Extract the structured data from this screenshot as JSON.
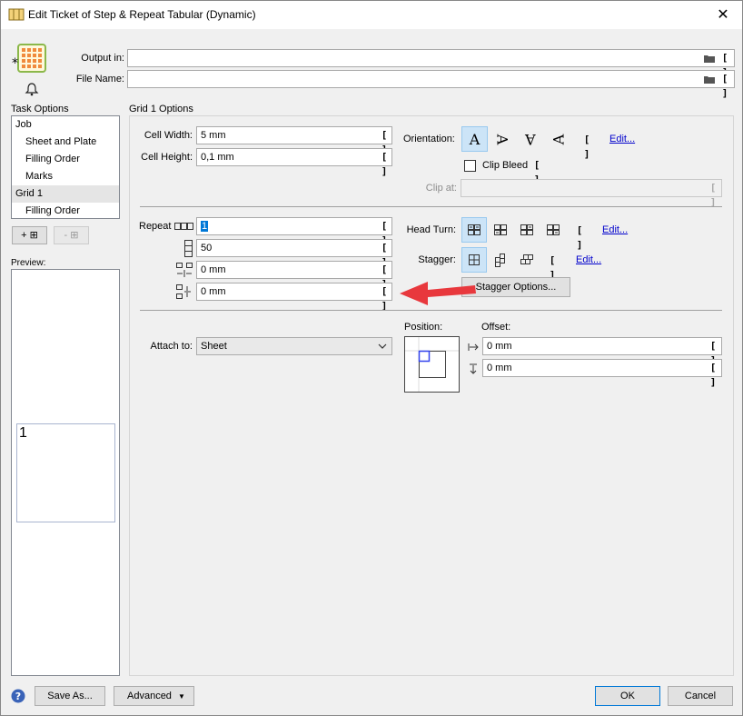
{
  "window": {
    "title": "Edit Ticket of Step & Repeat Tabular (Dynamic)"
  },
  "header": {
    "output_in_label": "Output in:",
    "output_in_value": "",
    "file_name_label": "File Name:",
    "file_name_value": ""
  },
  "task_options": {
    "label": "Task Options",
    "items": [
      {
        "label": "Job",
        "indent": false,
        "selected": false
      },
      {
        "label": "Sheet and Plate",
        "indent": true,
        "selected": false
      },
      {
        "label": "Filling Order",
        "indent": true,
        "selected": false
      },
      {
        "label": "Marks",
        "indent": true,
        "selected": false
      },
      {
        "label": "Grid 1",
        "indent": false,
        "selected": true
      },
      {
        "label": "Filling Order",
        "indent": true,
        "selected": false
      }
    ],
    "add_label": "+ ⊞",
    "remove_label": "- ⊞"
  },
  "preview": {
    "label": "Preview:",
    "page_number": "1"
  },
  "grid_options": {
    "title": "Grid 1 Options",
    "cell_width_label": "Cell Width:",
    "cell_width_value": "5 mm",
    "cell_height_label": "Cell Height:",
    "cell_height_value": "0,1 mm",
    "orientation_label": "Orientation:",
    "orientation_edit": "Edit...",
    "clip_bleed_label": "Clip Bleed",
    "clip_at_label": "Clip at:",
    "clip_at_value": "",
    "repeat_label": "Repeat",
    "repeat_h_value": "1",
    "repeat_v_value": "50",
    "gap_h_value": "0 mm",
    "gap_v_value": "0 mm",
    "head_turn_label": "Head Turn:",
    "head_turn_edit": "Edit...",
    "stagger_label": "Stagger:",
    "stagger_edit": "Edit...",
    "stagger_options_label": "Stagger Options...",
    "attach_to_label": "Attach to:",
    "attach_to_value": "Sheet",
    "position_label": "Position:",
    "offset_label": "Offset:",
    "offset_x_value": "0 mm",
    "offset_y_value": "0 mm"
  },
  "footer": {
    "save_as_label": "Save As...",
    "advanced_label": "Advanced",
    "ok_label": "OK",
    "cancel_label": "Cancel"
  },
  "colors": {
    "accent": "#0078d7",
    "selection": "#cce4f7",
    "annotation_arrow": "#e8383d",
    "link": "#0000cc"
  }
}
